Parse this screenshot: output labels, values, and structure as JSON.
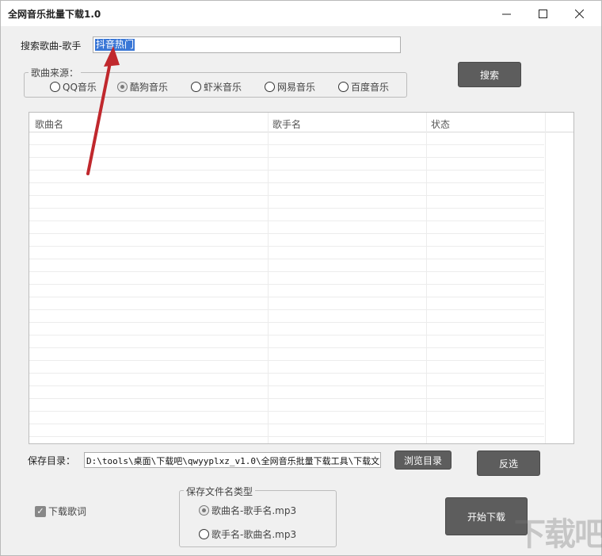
{
  "window": {
    "title": "全网音乐批量下载1.0",
    "minimize_glyph": "—",
    "maximize_glyph": "☐",
    "close_glyph": "✕"
  },
  "search": {
    "label": "搜索歌曲-歌手",
    "value": "抖音热门",
    "button": "搜索"
  },
  "source": {
    "legend": "歌曲来源：",
    "options": [
      {
        "label": "QQ音乐",
        "selected": false
      },
      {
        "label": "酷狗音乐",
        "selected": true
      },
      {
        "label": "虾米音乐",
        "selected": false
      },
      {
        "label": "网易音乐",
        "selected": false
      },
      {
        "label": "百度音乐",
        "selected": false
      }
    ]
  },
  "table": {
    "columns": [
      "歌曲名",
      "歌手名",
      "状态"
    ],
    "rows": []
  },
  "save_dir": {
    "label": "保存目录：",
    "value": "D:\\tools\\桌面\\下载吧\\qwyyplxz_v1.0\\全网音乐批量下载工具\\下载文",
    "browse_button": "浏览目录",
    "invert_button": "反选"
  },
  "lyrics": {
    "label": "下载歌词",
    "checked": true
  },
  "filename_type": {
    "legend": "保存文件名类型",
    "options": [
      {
        "label": "歌曲名-歌手名.mp3",
        "selected": true
      },
      {
        "label": "歌手名-歌曲名.mp3",
        "selected": false
      }
    ]
  },
  "start_button": "开始下载",
  "watermark": "下载吧",
  "colors": {
    "button_bg": "#5d5d5d",
    "selection_bg": "#3a77d6",
    "arrow": "#c0282d"
  }
}
